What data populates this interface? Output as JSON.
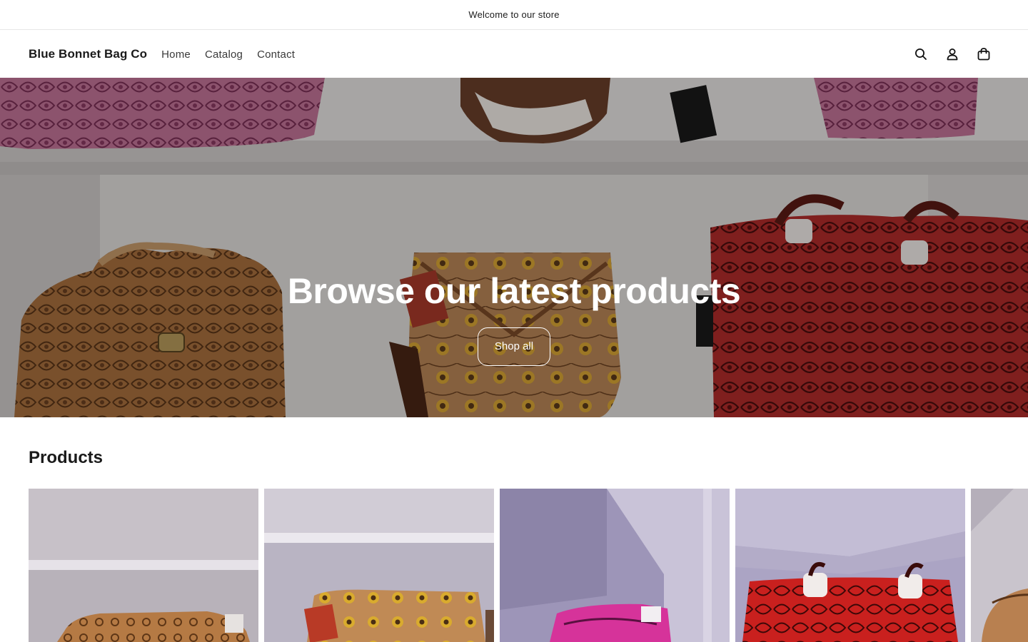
{
  "announcement": {
    "text": "Welcome to our store"
  },
  "header": {
    "brand": "Blue Bonnet Bag Co",
    "nav": [
      {
        "label": "Home"
      },
      {
        "label": "Catalog"
      },
      {
        "label": "Contact"
      }
    ],
    "icons": [
      "search-icon",
      "account-icon",
      "cart-icon"
    ]
  },
  "hero": {
    "title": "Browse our latest products",
    "button_label": "Shop all"
  },
  "products": {
    "heading": "Products",
    "items": [
      {
        "image": "tooled-leather-tan-bag"
      },
      {
        "image": "sunflower-tooled-crossbody"
      },
      {
        "image": "pink-tooled-wallet"
      },
      {
        "image": "red-tooled-tote"
      },
      {
        "image": "tan-tooled-purse"
      }
    ]
  },
  "colors": {
    "text": "#121212",
    "tan_leather": "#b07a4a",
    "pink_leather": "#c86aa0",
    "red_leather": "#b8302e",
    "hot_pink": "#e0339a"
  }
}
